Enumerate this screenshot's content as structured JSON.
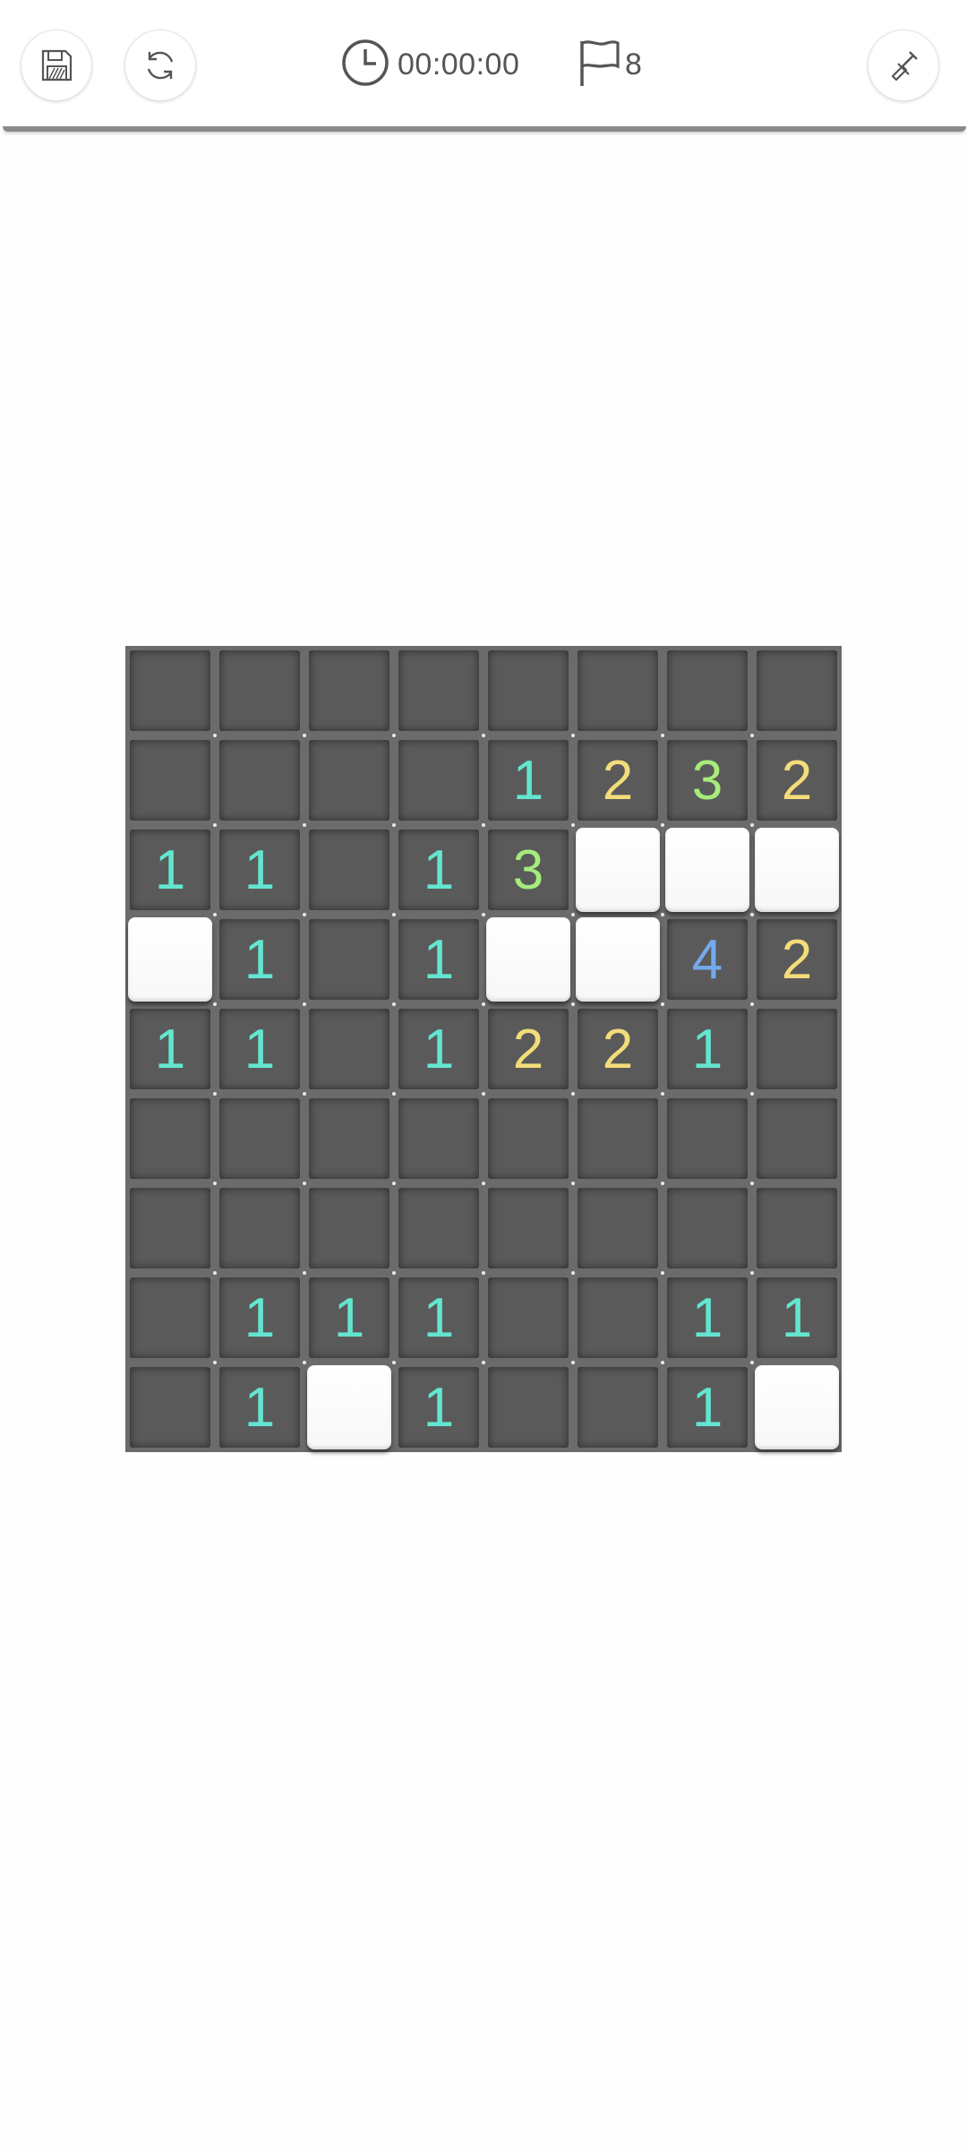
{
  "toolbar": {
    "save_icon": "save-icon",
    "restart_icon": "restart-icon",
    "timer_icon": "clock-icon",
    "timer_value": "00:00:00",
    "flag_icon": "flag-icon",
    "flag_count": "8",
    "dig_icon": "shovel-icon"
  },
  "colors": {
    "one": "#63e6d0",
    "two": "#f3dc7a",
    "three": "#a6ec7c",
    "four": "#74a9ec",
    "board": "#6b6b6b",
    "revealed_cell": "#5a5a5a",
    "covered_cell": "#ffffff"
  },
  "board": {
    "cols": 8,
    "rows_count": 9,
    "legend": "R = revealed empty, C = covered, digits = revealed number",
    "rows": [
      [
        "R",
        "R",
        "R",
        "R",
        "R",
        "R",
        "R",
        "R"
      ],
      [
        "R",
        "R",
        "R",
        "R",
        "1",
        "2",
        "3",
        "2"
      ],
      [
        "1",
        "1",
        "R",
        "1",
        "3",
        "C",
        "C",
        "C"
      ],
      [
        "C",
        "1",
        "R",
        "1",
        "C",
        "C",
        "4",
        "2"
      ],
      [
        "1",
        "1",
        "R",
        "1",
        "2",
        "2",
        "1",
        "R"
      ],
      [
        "R",
        "R",
        "R",
        "R",
        "R",
        "R",
        "R",
        "R"
      ],
      [
        "R",
        "R",
        "R",
        "R",
        "R",
        "R",
        "R",
        "R"
      ],
      [
        "R",
        "1",
        "1",
        "1",
        "R",
        "R",
        "1",
        "1"
      ],
      [
        "R",
        "1",
        "C",
        "1",
        "R",
        "R",
        "1",
        "C"
      ]
    ]
  }
}
